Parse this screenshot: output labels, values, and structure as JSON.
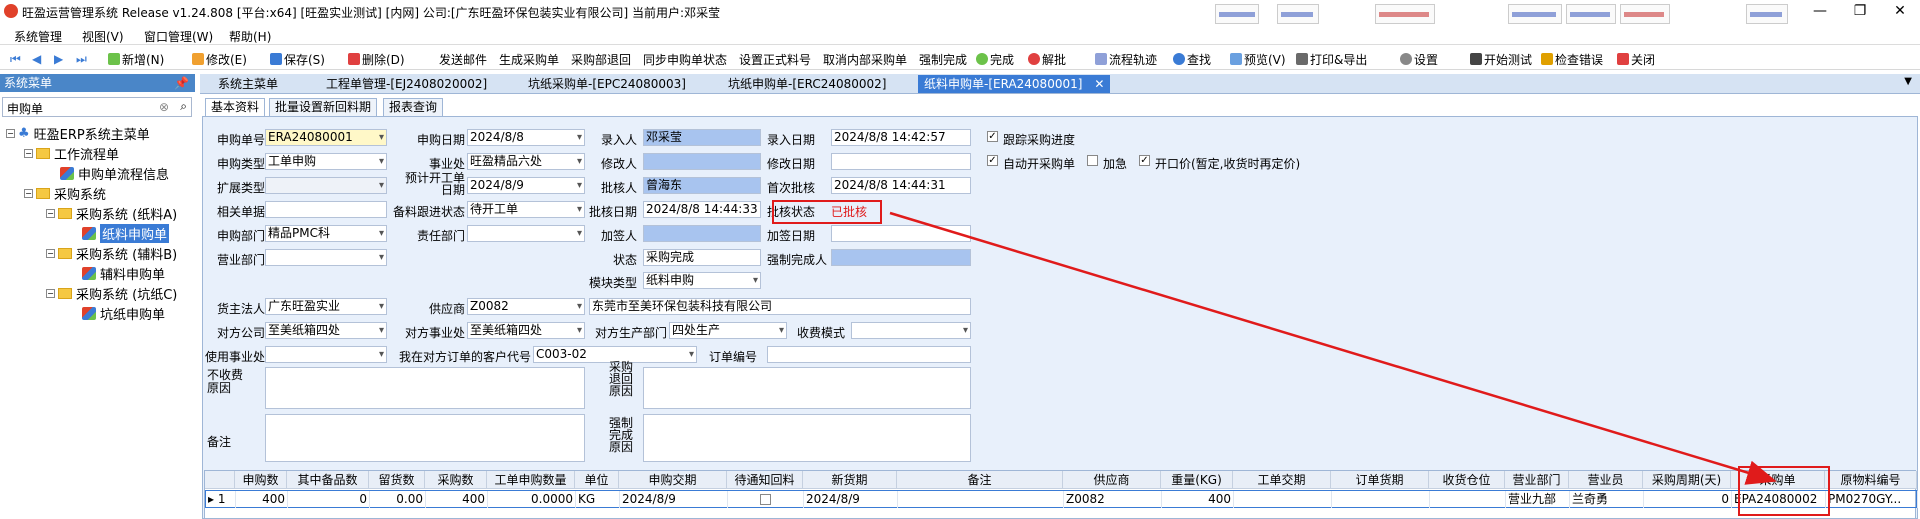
{
  "titlebar": {
    "title": "旺盈运营管理系统 Release v1.24.808 [平台:x64] [旺盈实业测试] [内网] 公司:[广东旺盈环保包装实业有限公司] 当前用户:邓采莹"
  },
  "menu": [
    "系统管理",
    "视图(V)",
    "窗口管理(W)",
    "帮助(H)"
  ],
  "toolbar": {
    "new": "新增(N)",
    "edit": "修改(E)",
    "save": "保存(S)",
    "delete": "删除(D)",
    "send_mail": "发送邮件",
    "gen_po": "生成采购单",
    "po_return": "采购部退回",
    "sync": "同步申购单状态",
    "set_code": "设置正式料号",
    "cancel": "取消内部采购单",
    "force": "强制完成",
    "done": "完成",
    "unapprove": "解批",
    "flow": "流程轨迹",
    "find": "查找",
    "preview": "预览(V)",
    "print": "打印&导出",
    "settings": "设置",
    "test": "开始测试",
    "check_err": "检查错误",
    "close": "关闭"
  },
  "sidebar": {
    "title": "系统菜单",
    "search_value": "申购单",
    "tree": [
      {
        "label": "旺盈ERP系统主菜单"
      },
      {
        "label": "工作流程单"
      },
      {
        "label": "申购单流程信息"
      },
      {
        "label": "采购系统"
      },
      {
        "label": "采购系统 (纸料A)"
      },
      {
        "label": "纸料申购单"
      },
      {
        "label": "采购系统 (辅料B)"
      },
      {
        "label": "辅料申购单"
      },
      {
        "label": "采购系统 (坑纸C)"
      },
      {
        "label": "坑纸申购单"
      }
    ]
  },
  "tabs": [
    "系统主菜单",
    "工程单管理-[EJ2408020002]",
    "坑纸采购单-[EPC24080003]",
    "坑纸申购单-[ERC24080002]",
    "纸料申购单-[ERA24080001]"
  ],
  "subtabs": [
    "基本资料",
    "批量设置新回料期",
    "报表查询"
  ],
  "form": {
    "req_no_label": "申购单号",
    "req_no": "ERA24080001",
    "req_date_label": "申购日期",
    "req_date": "2024/8/8",
    "entry_by_label": "录入人",
    "entry_by": "邓采莹",
    "entry_date_label": "录入日期",
    "entry_date": "2024/8/8 14:42:57",
    "track_label": "跟踪采购进度",
    "req_type_label": "申购类型",
    "req_type": "工单申购",
    "division_label": "事业处",
    "division": "旺盈精品六处",
    "modifier_label": "修改人",
    "modifier": "",
    "modify_date_label": "修改日期",
    "modify_date": "",
    "auto_po_label": "自动开采购单",
    "urgent_label": "加急",
    "open_price_label": "开口价(暂定,收货时再定价)",
    "ext_type_label": "扩展类型",
    "ext_type": "",
    "plan_date_label": "预计开工单\n日期",
    "plan_date": "2024/8/9",
    "approver_label": "批核人",
    "approver": "曾海东",
    "first_approve_label": "首次批核",
    "first_approve": "2024/8/8 14:44:31",
    "related_label": "相关单据",
    "related": "",
    "prep_status_label": "备料跟进状态",
    "prep_status": "待开工单",
    "approve_date_label": "批核日期",
    "approve_date": "2024/8/8 14:44:33",
    "approve_status_label": "批核状态",
    "approve_status": "已批核",
    "dept_label": "申购部门",
    "dept": "精品PMC科",
    "resp_dept_label": "责任部门",
    "resp_dept": "",
    "cosign_label": "加签人",
    "cosign": "",
    "cosign_date_label": "加签日期",
    "cosign_date": "",
    "sales_dept_label": "营业部门",
    "sales_dept": "",
    "status_label": "状态",
    "status": "采购完成",
    "force_by_label": "强制完成人",
    "force_by": "",
    "module_label": "模块类型",
    "module": "纸料申购",
    "owner_label": "货主法人",
    "owner": "广东旺盈实业",
    "supplier_label": "供应商",
    "supplier": "Z0082",
    "supplier_name": "东莞市至美环保包装科技有限公司",
    "counter_co_label": "对方公司",
    "counter_co": "至美纸箱四处",
    "counter_div_label": "对方事业处",
    "counter_div": "至美纸箱四处",
    "counter_prod_label": "对方生产部门",
    "counter_prod": "四处生产",
    "fee_mode_label": "收费模式",
    "fee_mode": "",
    "use_div_label": "使用事业处",
    "use_div": "",
    "cust_code_label": "我在对方订单的客户代号",
    "cust_code": "C003-02",
    "order_no_label": "订单编号",
    "order_no": "",
    "nofee_label": "不收费\n原因",
    "po_return_label": "采购\n退回\n原因",
    "remark_label": "备注",
    "force_reason_label": "强制\n完成\n原因"
  },
  "grid": {
    "headers": [
      "申购数",
      "其中备品数",
      "留货数",
      "采购数",
      "工单申购数量",
      "单位",
      "申购交期",
      "待通知回料",
      "新货期",
      "备注",
      "供应商",
      "重量(KG)",
      "工单交期",
      "订单货期",
      "收货仓位",
      "营业部门",
      "营业员",
      "采购周期(天)",
      "采购单",
      "原物料编号"
    ],
    "row": {
      "idx": "1",
      "cells": [
        "400",
        "0",
        "0.00",
        "400",
        "0.0000",
        "KG",
        "2024/8/9",
        "",
        "2024/8/9",
        "",
        "Z0082",
        "400",
        "",
        "",
        "",
        "营业九部",
        "兰奇勇",
        "0",
        "EPA24080002",
        "PM0270GY..."
      ]
    }
  },
  "colors": {
    "accent": "#3a7bd5",
    "highlight": "#e01b1b",
    "form_bg": "#e8f0fb"
  }
}
